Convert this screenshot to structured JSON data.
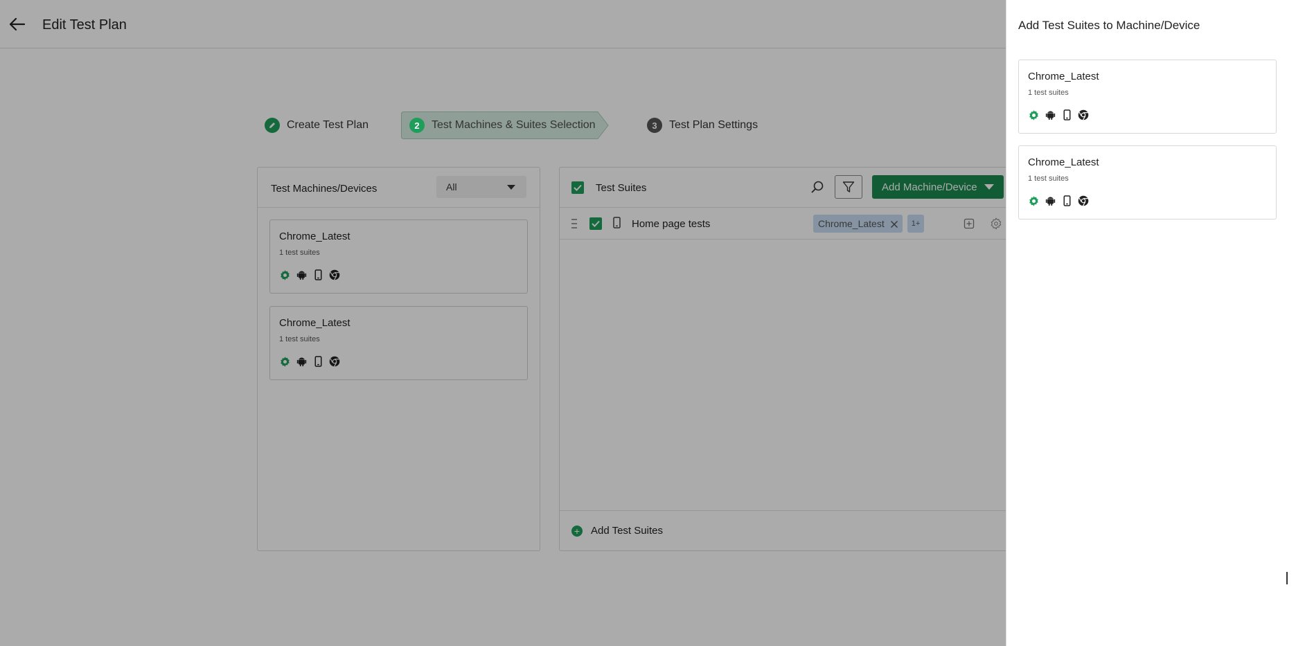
{
  "header": {
    "title": "Edit Test Plan"
  },
  "stepper": {
    "steps": [
      {
        "label": "Create Test Plan",
        "status": "done",
        "badge": ""
      },
      {
        "label": "Test Machines & Suites Selection",
        "status": "active",
        "badge": "2"
      },
      {
        "label": "Test Plan Settings",
        "status": "pending",
        "badge": "3"
      }
    ]
  },
  "machines_panel": {
    "title": "Test Machines/Devices",
    "filter_value": "All",
    "cards": [
      {
        "name": "Chrome_Latest",
        "suites": "1 test suites",
        "icons": [
          "gear-icon",
          "android-icon",
          "mobile-phone-icon",
          "chrome-icon"
        ]
      },
      {
        "name": "Chrome_Latest",
        "suites": "1 test suites",
        "icons": [
          "gear-icon",
          "android-icon",
          "mobile-phone-icon",
          "chrome-icon"
        ]
      }
    ]
  },
  "suites_panel": {
    "title": "Test Suites",
    "add_machine_label": "Add Machine/Device",
    "rows": [
      {
        "name": "Home page tests",
        "machine_chip": "Chrome_Latest",
        "more_chip": "1+"
      }
    ],
    "add_suites_label": "Add Test Suites"
  },
  "drawer": {
    "title": "Add Test Suites to Machine/Device",
    "cards": [
      {
        "name": "Chrome_Latest",
        "suites": "1 test suites"
      },
      {
        "name": "Chrome_Latest",
        "suites": "1 test suites"
      }
    ]
  },
  "colors": {
    "brand_green": "#1e9e5a",
    "button_green": "#1a8a4f",
    "chip_blue": "#c7dbf2",
    "overlay": "rgba(0,0,0,0.33)"
  }
}
